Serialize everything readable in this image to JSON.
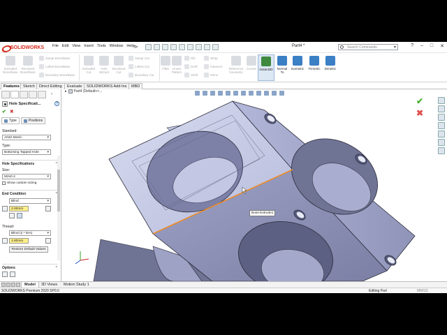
{
  "app": {
    "brand": "SOLIDWORKS",
    "document_title": "Part4 *",
    "menus": [
      "File",
      "Edit",
      "View",
      "Insert",
      "Tools",
      "Window",
      "Help"
    ],
    "search_placeholder": "Search Commands"
  },
  "ribbon": {
    "features_large": [
      "Extruded Boss/Base",
      "Revolved Boss/Base",
      "Extruded Cut",
      "Hole Wizard",
      "Revolved Cut",
      "Fillet",
      "Linear Pattern",
      "Reference Geometry",
      "Curves",
      "Instant3D",
      "Normal To",
      "Isometric",
      "Trimetric",
      "Dimetric"
    ],
    "features_small": [
      "Swept Boss/Base",
      "Lofted Boss/Base",
      "Boundary Boss/Base",
      "Swept Cut",
      "Lofted Cut",
      "Boundary Cut",
      "Rib",
      "Draft",
      "Shell",
      "Wrap",
      "Intersect",
      "Mirror"
    ],
    "active_button": "Instant3D"
  },
  "command_tabs": [
    "Features",
    "Sketch",
    "Direct Editing",
    "Evaluate",
    "SOLIDWORKS Add-Ins",
    "MBD"
  ],
  "active_command_tab": "Features",
  "feature_tree": {
    "label": "Part4  (Default<<..."
  },
  "property_manager": {
    "title": "Hole Specificati...",
    "subtabs": [
      "Type",
      "Positions"
    ],
    "standard_label": "Standard:",
    "standard_value": "ANSI Metric",
    "type_label": "Type:",
    "type_value": "Bottoming Tapped Hole",
    "hole_spec_section": "Hole Specifications",
    "size_label": "Size:",
    "size_value": "M2x0.4",
    "show_custom_sizing": "Show custom sizing",
    "end_condition_section": "End Condition",
    "end_condition_value": "Blind",
    "depth_value": "2.00mm",
    "thread_label": "Thread:",
    "thread_value": "Blind (2 * DIA)",
    "thread_depth_value": "1.60mm",
    "restore_button": "Restore Default Values",
    "options_section": "Options"
  },
  "viewport": {
    "tooltip": "Boss-Extrude1",
    "colors": {
      "face_light": "#c6cbe6",
      "face_mid": "#a9aed0",
      "face_dark": "#6f7394",
      "edge": "#2b2b3a",
      "selected_edge": "#f08a24"
    }
  },
  "bottom_tabs": [
    "Model",
    "3D Views",
    "Motion Study 1"
  ],
  "active_bottom_tab": "Model",
  "status": {
    "left": "SOLIDWORKS Premium 2020 SP0.0",
    "editing": "Editing Part",
    "units": "MMGS"
  }
}
